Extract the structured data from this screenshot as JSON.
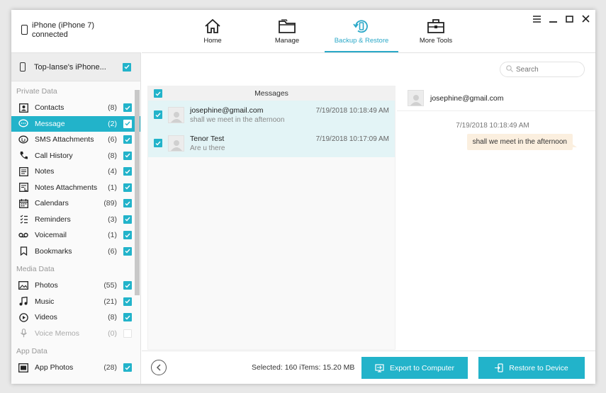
{
  "device": {
    "line1": "iPhone (iPhone 7)",
    "line2": "connected"
  },
  "nav": [
    {
      "label": "Home",
      "icon": "home-icon"
    },
    {
      "label": "Manage",
      "icon": "folder-icon"
    },
    {
      "label": "Backup & Restore",
      "icon": "backup-restore-icon"
    },
    {
      "label": "More Tools",
      "icon": "toolbox-icon"
    }
  ],
  "sidebar": {
    "device_label": "Top-lanse's iPhone...",
    "sections": {
      "private": "Private Data",
      "media": "Media Data",
      "app": "App Data"
    },
    "private_items": [
      {
        "label": "Contacts",
        "count": "(8)"
      },
      {
        "label": "Message",
        "count": "(2)"
      },
      {
        "label": "SMS Attachments",
        "count": "(6)"
      },
      {
        "label": "Call History",
        "count": "(8)"
      },
      {
        "label": "Notes",
        "count": "(4)"
      },
      {
        "label": "Notes Attachments",
        "count": "(1)"
      },
      {
        "label": "Calendars",
        "count": "(89)"
      },
      {
        "label": "Reminders",
        "count": "(3)"
      },
      {
        "label": "Voicemail",
        "count": "(1)"
      },
      {
        "label": "Bookmarks",
        "count": "(6)"
      }
    ],
    "media_items": [
      {
        "label": "Photos",
        "count": "(55)"
      },
      {
        "label": "Music",
        "count": "(21)"
      },
      {
        "label": "Videos",
        "count": "(8)"
      },
      {
        "label": "Voice Memos",
        "count": "(0)"
      }
    ],
    "app_items": [
      {
        "label": "App Photos",
        "count": "(28)"
      }
    ]
  },
  "search": {
    "placeholder": "Search"
  },
  "messages": {
    "header": "Messages",
    "rows": [
      {
        "name": "josephine@gmail.com",
        "preview": "shall we meet in the afternoon",
        "time": "7/19/2018 10:18:49 AM"
      },
      {
        "name": "Tenor Test",
        "preview": "Are u there",
        "time": "7/19/2018 10:17:09 AM"
      }
    ]
  },
  "conversation": {
    "contact": "josephine@gmail.com",
    "time": "7/19/2018 10:18:49 AM",
    "bubble": "shall we meet in the afternoon"
  },
  "footer": {
    "selected": "Selected: 160 iTems: 15.20 MB",
    "export_label": "Export to Computer",
    "restore_label": "Restore to Device"
  },
  "colors": {
    "accent": "#22b3ca",
    "bubble": "#fbefdf",
    "row_selected": "#e3f4f6"
  }
}
